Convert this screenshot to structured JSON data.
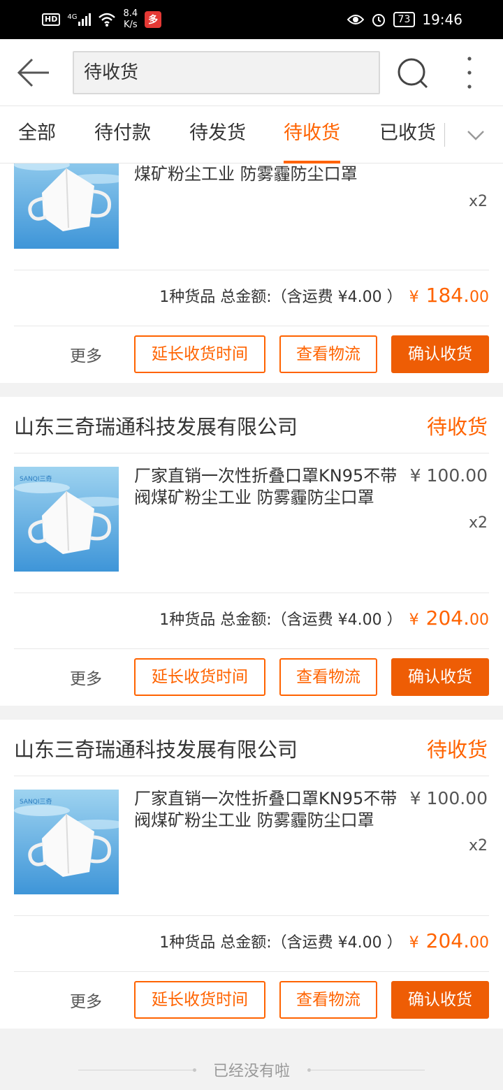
{
  "status_bar": {
    "hd": "HD",
    "net_type": "4G",
    "speed_value": "8.4",
    "speed_unit": "K/s",
    "battery": "73",
    "time": "19:46"
  },
  "header": {
    "search_value": "待收货"
  },
  "tabs": [
    {
      "label": "全部"
    },
    {
      "label": "待付款"
    },
    {
      "label": "待发货"
    },
    {
      "label": "待收货"
    },
    {
      "label": "已收货"
    }
  ],
  "orders": [
    {
      "product_name": "煤矿粉尘工业 防雾霾防尘口罩",
      "qty": "x2",
      "total_prefix": "1种货品 总金额:（含运费 ¥4.00 ）",
      "currency": "¥",
      "total_int": "184.",
      "total_dec": "00",
      "more": "更多",
      "btn_extend": "延长收货时间",
      "btn_logistics": "查看物流",
      "btn_confirm": "确认收货"
    },
    {
      "shop": "山东三奇瑞通科技发展有限公司",
      "status": "待收货",
      "product_name": "厂家直销一次性折叠口罩KN95不带阀煤矿粉尘工业 防雾霾防尘口罩",
      "price": "¥ 100.00",
      "qty": "x2",
      "total_prefix": "1种货品 总金额:（含运费 ¥4.00 ）",
      "currency": "¥",
      "total_int": "204.",
      "total_dec": "00",
      "more": "更多",
      "btn_extend": "延长收货时间",
      "btn_logistics": "查看物流",
      "btn_confirm": "确认收货"
    },
    {
      "shop": "山东三奇瑞通科技发展有限公司",
      "status": "待收货",
      "product_name": "厂家直销一次性折叠口罩KN95不带阀煤矿粉尘工业 防雾霾防尘口罩",
      "price": "¥ 100.00",
      "qty": "x2",
      "total_prefix": "1种货品 总金额:（含运费 ¥4.00 ）",
      "currency": "¥",
      "total_int": "204.",
      "total_dec": "00",
      "more": "更多",
      "btn_extend": "延长收货时间",
      "btn_logistics": "查看物流",
      "btn_confirm": "确认收货"
    }
  ],
  "thumb_brand": "SANQI三奇",
  "end_message": "已经没有啦",
  "colors": {
    "accent": "#ff6300",
    "confirm": "#ee5d05"
  }
}
